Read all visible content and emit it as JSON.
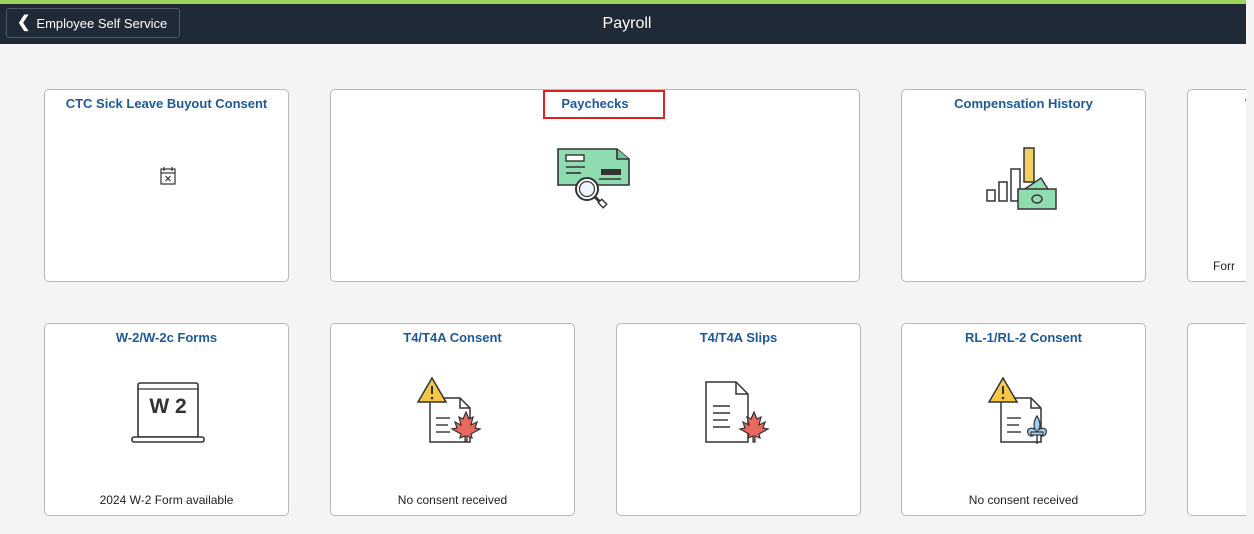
{
  "header": {
    "back_label": "Employee Self Service",
    "title": "Payroll"
  },
  "tiles": [
    {
      "title": "CTC Sick Leave Buyout Consent",
      "footer": "",
      "icon": "calendar-x-icon"
    },
    {
      "title": "Paychecks",
      "footer": "",
      "icon": "paycheck-search-icon"
    },
    {
      "title": "Compensation History",
      "footer": "",
      "icon": "bar-chart-money-icon"
    },
    {
      "title": "W",
      "footer": "Forr",
      "icon": ""
    },
    {
      "title": "W-2/W-2c Forms",
      "footer": "2024 W-2 Form available",
      "icon": "w2-laptop-icon"
    },
    {
      "title": "T4/T4A Consent",
      "footer": "No consent received",
      "icon": "warning-document-maple-icon"
    },
    {
      "title": "T4/T4A Slips",
      "footer": "",
      "icon": "document-maple-icon"
    },
    {
      "title": "RL-1/RL-2 Consent",
      "footer": "No consent received",
      "icon": "warning-document-fleur-icon"
    },
    {
      "title": "",
      "footer": "",
      "icon": ""
    }
  ],
  "icons": {
    "w2_text": "W 2"
  },
  "colors": {
    "header_bg": "#1f2a36",
    "tile_title": "#1d5a9c",
    "highlight": "#e0201f",
    "accent_green": "#9cd35b"
  }
}
